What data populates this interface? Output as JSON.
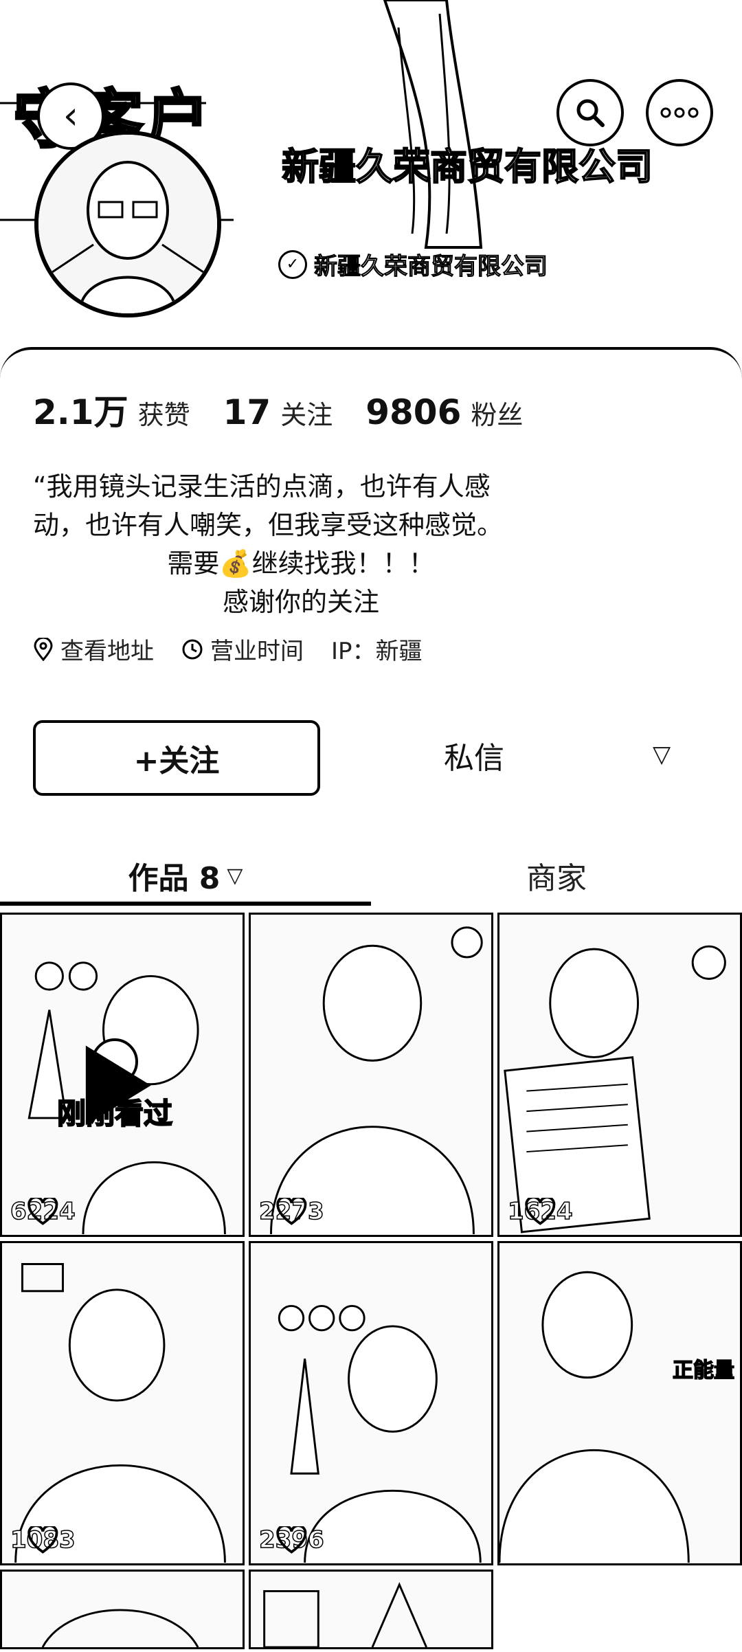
{
  "status_bar": {
    "time": "",
    "right": ""
  },
  "header": {
    "banner_text": "守客户",
    "name": "新疆久荣商贸有限公司",
    "verified_label": "新疆久荣商贸有限公司"
  },
  "stats": {
    "likes_num": "2.1万",
    "likes_label": "获赞",
    "following_num": "17",
    "following_label": "关注",
    "followers_num": "9806",
    "followers_label": "粉丝"
  },
  "bio": {
    "line1": "“我用镜头记录生活的点滴，也许有人感",
    "line2": "动，也许有人嘲笑，但我享受这种感觉。",
    "line3": "需要💰继续找我！！！",
    "line4": "感谢你的关注"
  },
  "meta": {
    "address": "查看地址",
    "hours": "营业时间",
    "ip": "IP：新疆"
  },
  "actions": {
    "follow": "+关注",
    "message": "私信"
  },
  "tabs": {
    "works": "作品 8",
    "shop": "商家"
  },
  "videos": [
    {
      "likes": "6224",
      "badge": "刚刚看过"
    },
    {
      "likes": "2273"
    },
    {
      "likes": "1624"
    },
    {
      "likes": "1083"
    },
    {
      "likes": "2396"
    },
    {
      "likes": "",
      "caption": "正能量"
    }
  ]
}
